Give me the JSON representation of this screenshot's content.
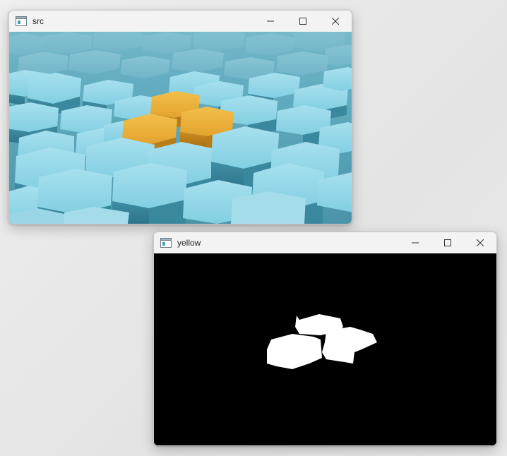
{
  "windows": [
    {
      "title": "src",
      "icons": {
        "app": "app-window-icon",
        "minimize": "minimize-icon",
        "maximize": "maximize-icon",
        "close": "close-icon"
      },
      "content": "camera-image-blue-hexagons-with-yellow-cluster"
    },
    {
      "title": "yellow",
      "icons": {
        "app": "app-window-icon",
        "minimize": "minimize-icon",
        "maximize": "maximize-icon",
        "close": "close-icon"
      },
      "content": "binary-mask-white-on-black"
    }
  ],
  "colors": {
    "hex_blue": "#7cc9dc",
    "hex_blue_dark": "#4d9fb5",
    "hex_yellow": "#e8ac38",
    "mask_background": "#000000",
    "mask_foreground": "#ffffff"
  }
}
